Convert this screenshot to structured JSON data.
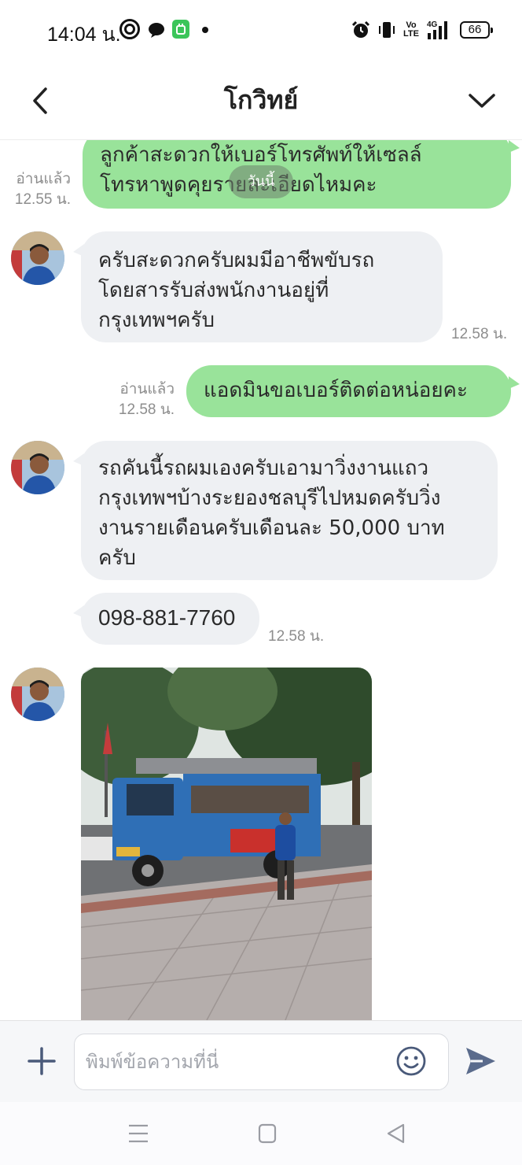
{
  "status_bar": {
    "time": "14:04 น.",
    "battery": "66",
    "volte": [
      "Vo",
      "LTE"
    ],
    "network": "4G"
  },
  "header": {
    "title": "โกวิทย์"
  },
  "messages": [
    {
      "direction": "out",
      "lines": [
        "ลูกค้าสะดวกให้เบอร์โทรศัพท์ให้เซลล์",
        "โทรหาพูดคุยรายละเอียดไหมคะ"
      ],
      "read": "อ่านแล้ว",
      "time": "12.55 น."
    },
    {
      "direction": "in",
      "lines": [
        "ครับสะดวกครับผมมีอาชีพขับรถ",
        "โดยสารรับส่งพนักงานอยู่ที่",
        "กรุงเทพฯครับ"
      ],
      "time": "12.58 น."
    },
    {
      "direction": "out",
      "lines": [
        "แอดมินขอเบอร์ติดต่อหน่อยคะ"
      ],
      "read": "อ่านแล้ว",
      "time": "12.58 น."
    },
    {
      "direction": "in",
      "lines": [
        "รถคันนี้รถผมเองครับเอามาวิ่งงานแถว",
        "กรุงเทพฯบ้างระยองชลบุรีไปหมดครับวิ่ง",
        "งานรายเดือนครับเดือนละ 50,000 บาท",
        "ครับ"
      ]
    },
    {
      "direction": "in",
      "lines": [
        "098-881-7760"
      ],
      "time": "12.58 น."
    },
    {
      "direction": "in",
      "type": "photo"
    }
  ],
  "date_divider": "วันนี้",
  "input": {
    "placeholder": "พิมพ์ข้อความที่นี่"
  },
  "icons": {
    "back": "chevron-left-icon",
    "menu": "chevron-down-icon",
    "add": "plus-icon",
    "emoji": "smiley-icon",
    "send": "send-icon",
    "nav_recent": "menu-lines-icon",
    "nav_home": "square-icon",
    "nav_back": "triangle-back-icon"
  },
  "colors": {
    "outgoing_bubble": "#99e39a",
    "incoming_bubble": "#eef0f3",
    "send_icon": "#5a6b8c"
  }
}
